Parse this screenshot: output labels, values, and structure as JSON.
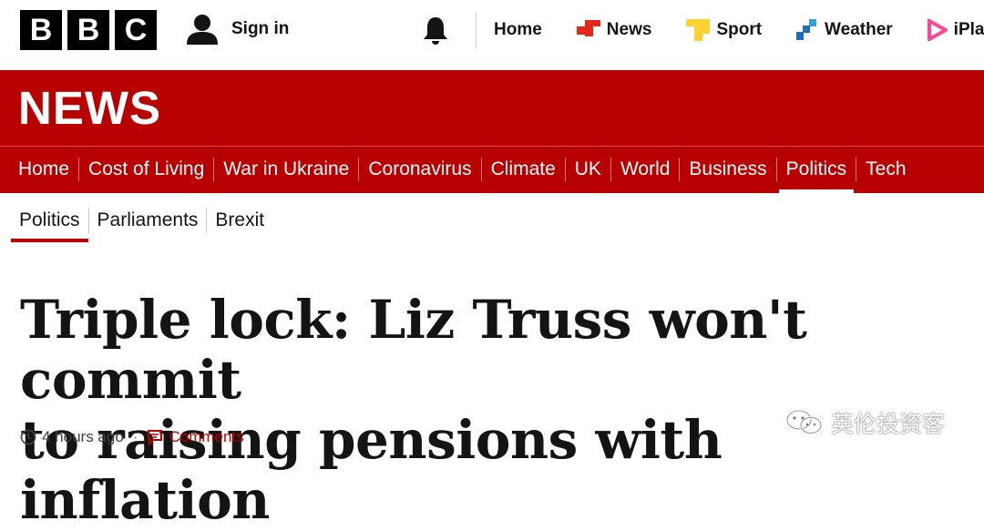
{
  "header": {
    "logo_letters": [
      "B",
      "B",
      "C"
    ],
    "signin_label": "Sign in",
    "nav": [
      {
        "label": "Home",
        "icon": "none"
      },
      {
        "label": "News",
        "icon": "news-icon",
        "color": "#e4281e"
      },
      {
        "label": "Sport",
        "icon": "sport-icon",
        "color": "#ffd230"
      },
      {
        "label": "Weather",
        "icon": "weather-icon",
        "color": "#1d70b8"
      },
      {
        "label": "iPlaye",
        "icon": "iplayer-icon",
        "color": "#f54997"
      }
    ]
  },
  "section": {
    "title": "NEWS",
    "categories": [
      "Home",
      "Cost of Living",
      "War in Ukraine",
      "Coronavirus",
      "Climate",
      "UK",
      "World",
      "Business",
      "Politics",
      "Tech"
    ],
    "active_category": "Politics"
  },
  "subnav": {
    "items": [
      "Politics",
      "Parliaments",
      "Brexit"
    ],
    "active": "Politics"
  },
  "article": {
    "headline_line1": "Triple lock: Liz Truss won't commit",
    "headline_line2": "to raising pensions with inflation",
    "time": "4 hours ago",
    "separator": "·",
    "comments_label": "Comments"
  },
  "watermark": {
    "text": "英伦投资客"
  },
  "colors": {
    "brand_red": "#b80000",
    "text": "#141414"
  }
}
